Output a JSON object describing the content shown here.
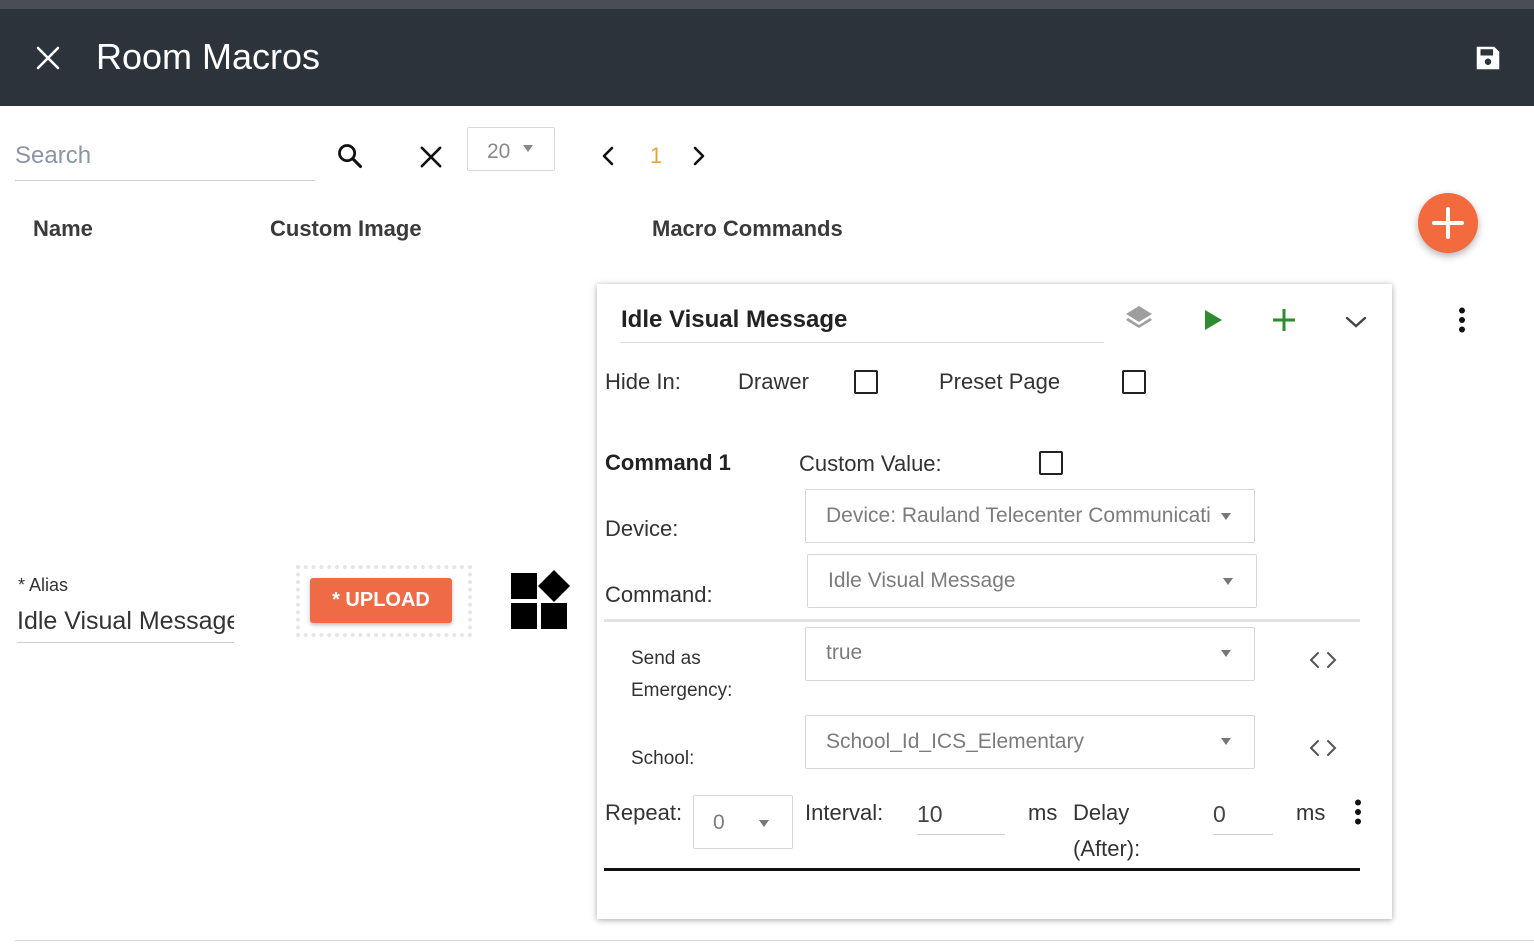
{
  "header": {
    "title": "Room Macros"
  },
  "toolbar": {
    "search_placeholder": "Search",
    "page_size": "20",
    "current_page": "1"
  },
  "columns": {
    "name": "Name",
    "custom_image": "Custom Image",
    "macro_commands": "Macro Commands"
  },
  "row": {
    "alias_label": "* Alias",
    "alias_value": "Idle Visual Message",
    "upload_label": "* UPLOAD"
  },
  "macro": {
    "title": "Idle Visual Message",
    "hide_in_label": "Hide In:",
    "drawer_label": "Drawer",
    "preset_page_label": "Preset Page",
    "command_heading": "Command 1",
    "custom_value_label": "Custom Value:",
    "device_label": "Device:",
    "device_value": "Device: Rauland Telecenter Communications",
    "command_label": "Command:",
    "command_value": "Idle Visual Message",
    "send_emergency_label_1": "Send as",
    "send_emergency_label_2": "Emergency:",
    "send_emergency_value": "true",
    "school_label": "School:",
    "school_value": "School_Id_ICS_Elementary",
    "repeat_label": "Repeat:",
    "repeat_value": "0",
    "interval_label": "Interval:",
    "interval_value": "10",
    "interval_unit": "ms",
    "delay_label_1": "Delay",
    "delay_label_2": "(After):",
    "delay_value": "0",
    "delay_unit": "ms"
  },
  "colors": {
    "header_bg": "#2d333b",
    "accent_orange": "#f26a3d",
    "play_green": "#2e8b2e",
    "page_number": "#e8a13a"
  }
}
